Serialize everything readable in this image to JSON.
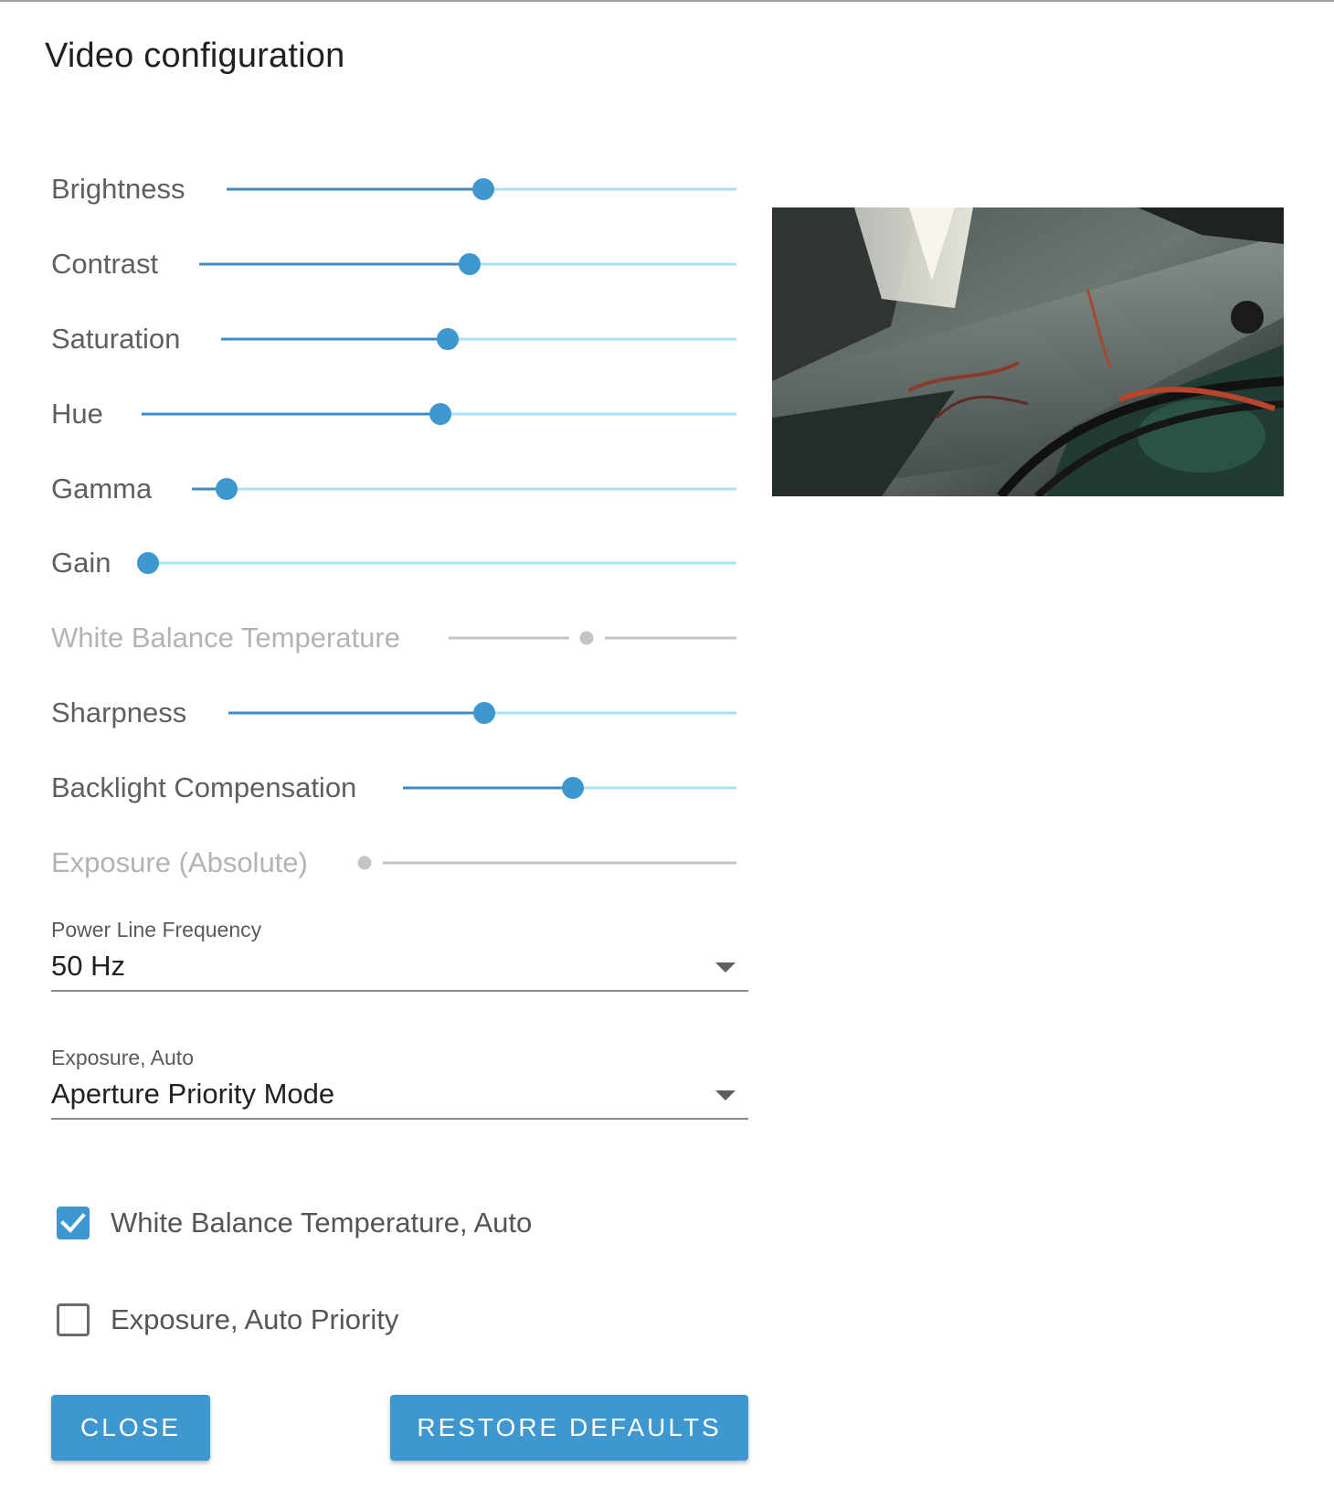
{
  "dialog": {
    "title": "Video configuration"
  },
  "sliders": [
    {
      "id": "brightness",
      "label": "Brightness",
      "value_fraction": 0.5,
      "disabled": false
    },
    {
      "id": "contrast",
      "label": "Contrast",
      "value_fraction": 0.5,
      "disabled": false
    },
    {
      "id": "saturation",
      "label": "Saturation",
      "value_fraction": 0.43,
      "disabled": false
    },
    {
      "id": "hue",
      "label": "Hue",
      "value_fraction": 0.5,
      "disabled": false
    },
    {
      "id": "gamma",
      "label": "Gamma",
      "value_fraction": 0.06,
      "disabled": false
    },
    {
      "id": "gain",
      "label": "Gain",
      "value_fraction": 0.0,
      "disabled": false
    },
    {
      "id": "white-balance-temperature",
      "label": "White Balance Temperature",
      "value_fraction": 0.48,
      "disabled": true
    },
    {
      "id": "sharpness",
      "label": "Sharpness",
      "value_fraction": 0.5,
      "disabled": false
    },
    {
      "id": "backlight-compensation",
      "label": "Backlight Compensation",
      "value_fraction": 0.5,
      "disabled": false
    },
    {
      "id": "exposure-absolute",
      "label": "Exposure (Absolute)",
      "value_fraction": 0.0,
      "disabled": true
    }
  ],
  "selects": {
    "power_line_frequency": {
      "caption": "Power Line Frequency",
      "value": "50 Hz"
    },
    "exposure_auto": {
      "caption": "Exposure, Auto",
      "value": "Aperture Priority Mode"
    }
  },
  "checkboxes": {
    "white_balance_auto": {
      "label": "White Balance Temperature, Auto",
      "checked": true
    },
    "exposure_auto_priority": {
      "label": "Exposure, Auto Priority",
      "checked": false
    }
  },
  "buttons": {
    "close": "CLOSE",
    "restore_defaults": "RESTORE DEFAULTS"
  },
  "preview": {
    "icon": "camera-preview-image"
  },
  "colors": {
    "accent": "#3f97d0",
    "track_fill": "#3b8ec8",
    "track_rest": "#a6e3f5",
    "disabled": "#c4c4c4"
  }
}
